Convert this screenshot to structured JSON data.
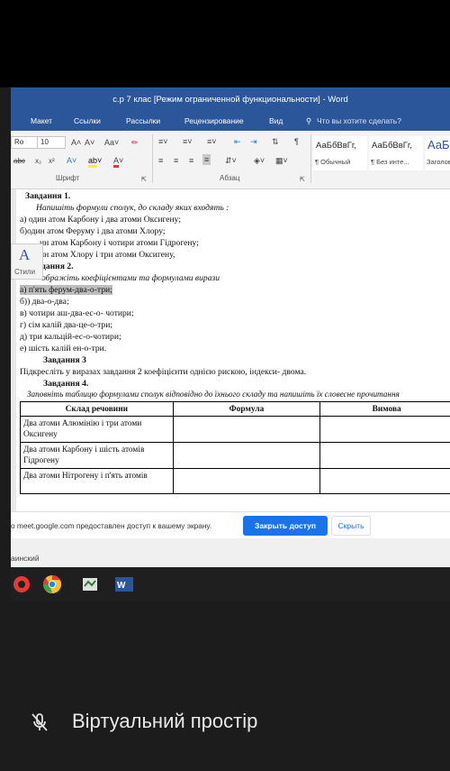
{
  "window": {
    "title": "с.р 7 клас [Режим ограниченной функциональности] - Word"
  },
  "ribbon": {
    "tabs": [
      "Макет",
      "Ссылки",
      "Рассылки",
      "Рецензирование",
      "Вид"
    ],
    "tell_me": "Что вы хотите сделать?",
    "font_name": "Ro",
    "font_size": "10",
    "font_group_label": "Шрифт",
    "paragraph_group_label": "Абзац",
    "styles": [
      {
        "preview": "АаБбВвГг,",
        "name": "¶ Обычный"
      },
      {
        "preview": "АаБбВвГг,",
        "name": "¶ Без инте..."
      },
      {
        "preview": "АаБ",
        "name": "Заголов"
      }
    ],
    "styles_pane_label": "Стили"
  },
  "document": {
    "lines": [
      "Завдання 1.",
      "Напишіть формули сполук, до складу яких входять :",
      "а) один атом Карбону і два атоми Оксигену;",
      "б)один атом Феруму і два атоми Хлору;",
      "ин атом Карбону і чотири атоми Гідрогену;",
      "ин атом Хлору і три атоми Оксигену,",
      "дання 2.",
      "ображіть коефіцієнтами та формулами вирази",
      "а) п'ять ферум-два-о-три;",
      "б)) два-о-два;",
      "в) чотири аш-два-ес-о- чотири;",
      "г) сім калій два-це-о-три;",
      "д) три кальцій-ес-о-чотири;",
      "е) шість калій ен-о-три.",
      "Завдання 3",
      "Підкресліть у виразах завдання 2 коефіцієнти однією рискою, індекси- двома.",
      "Завдання 4.",
      "Заповніть таблицю формулами сполук відповідно до їхнього складу та напишіть їх словесне прочитання"
    ],
    "table": {
      "headers": [
        "Склад речовини",
        "Формула",
        "Вимова"
      ],
      "rows": [
        [
          "Два атоми Алюмінію і три атоми Оксигену",
          "",
          ""
        ],
        [
          "Два атоми Карбону і шість атомів Гідрогену",
          "",
          ""
        ],
        [
          "Два атоми Нітрогену і п'ять атомів",
          "",
          ""
        ]
      ]
    }
  },
  "sharing": {
    "message": "о meet.google.com предоставлен доступ к вашему экрану.",
    "share_button": "Закрыть доступ",
    "hide_button": "Скрыть"
  },
  "status": {
    "language": "аинский"
  },
  "bottom": {
    "label": "Віртуальний простір"
  },
  "colors": {
    "word_blue": "#2b579a",
    "share_blue": "#1a73e8"
  }
}
